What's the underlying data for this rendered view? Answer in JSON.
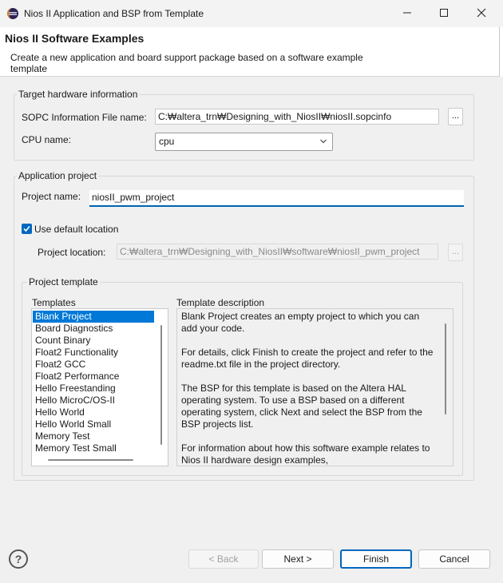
{
  "window": {
    "title": "Nios II Application and BSP from Template"
  },
  "header": {
    "title": "Nios II Software Examples",
    "description": "Create a new application and board support package based on a software example template"
  },
  "target_hw": {
    "group_label": "Target hardware information",
    "sopc_label": "SOPC Information File name:",
    "sopc_value": "C:₩altera_trn₩Designing_with_NiosII₩niosII.sopcinfo",
    "browse_label": "...",
    "cpu_label": "CPU name:",
    "cpu_value": "cpu"
  },
  "app_project": {
    "group_label": "Application project",
    "name_label": "Project name:",
    "name_value": "niosII_pwm_project",
    "use_default_label": "Use default location",
    "use_default_checked": true,
    "location_label": "Project location:",
    "location_value": "C:₩altera_trn₩Designing_with_NiosII₩software₩niosII_pwm_project",
    "location_browse_label": "..."
  },
  "project_template": {
    "group_label": "Project template",
    "templates_label": "Templates",
    "description_label": "Template description",
    "templates": [
      "Blank Project",
      "Board Diagnostics",
      "Count Binary",
      "Float2 Functionality",
      "Float2 GCC",
      "Float2 Performance",
      "Hello Freestanding",
      "Hello MicroC/OS-II",
      "Hello World",
      "Hello World Small",
      "Memory Test",
      "Memory Test Small"
    ],
    "selected_template": "Blank Project",
    "description": "Blank Project creates an empty project to which you can add your code.\n\nFor details, click Finish to create the project and refer to the readme.txt file in the project directory.\n\nThe BSP for this template is based on the Altera HAL operating system. To use a BSP based on a different operating system, click Next and select the BSP from the BSP projects list.\n\nFor information about how this software example relates to Nios II hardware design examples,"
  },
  "buttons": {
    "help_label": "?",
    "back_label": "< Back",
    "next_label": "Next >",
    "finish_label": "Finish",
    "cancel_label": "Cancel"
  },
  "colors": {
    "accent": "#0067c0",
    "selection": "#0078d7"
  },
  "icons": {
    "app": "eclipse-icon",
    "minimize": "minimize-icon",
    "maximize": "maximize-icon",
    "close": "close-icon",
    "dropdown": "chevron-down-icon",
    "check": "checkmark-icon",
    "help": "help-icon"
  }
}
